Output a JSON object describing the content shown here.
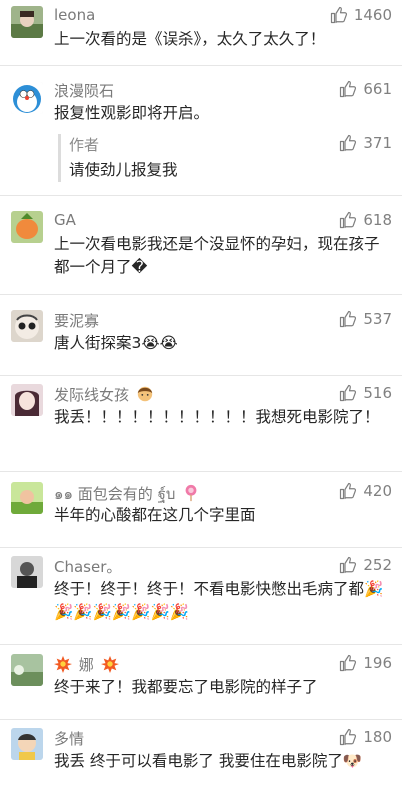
{
  "comments": [
    {
      "user": "leona",
      "likes": "1460",
      "text": "上一次看的是《误杀》，太久了太久了！"
    },
    {
      "user": "浪漫陨石",
      "likes": "661",
      "text": "报复性观影即将开启。",
      "reply": {
        "author": "作者",
        "likes": "371",
        "text": "请使劲儿报复我"
      }
    },
    {
      "user": "GA",
      "likes": "618",
      "text": "上一次看电影我还是个没显怀的孕妇，现在孩子都一个月了�"
    },
    {
      "user": "要泥寡",
      "likes": "537",
      "text": "唐人街探案3😭😭"
    },
    {
      "user": "发际线女孩",
      "likes": "516",
      "text": "我丢！！！！！！！！！！！我想死电影院了！"
    },
    {
      "user": "๑๑ 面包会有的 ฐ์บ",
      "likes": "420",
      "text": "半年的心酸都在这几个字里面"
    },
    {
      "user": "Chaser。",
      "likes": "252",
      "text": "终于！终于！终于！不看电影快憋出毛病了都🎉🎉🎉🎉🎉🎉🎉🎉"
    },
    {
      "user": "娜",
      "likes": "196",
      "text": "终于来了！我都要忘了电影院的样子了"
    },
    {
      "user": "多情",
      "likes": "180",
      "text": "我丢 终于可以看电影了 我要住在电影院了🐶"
    }
  ],
  "icons": {
    "like": "thumbs-up-icon"
  }
}
